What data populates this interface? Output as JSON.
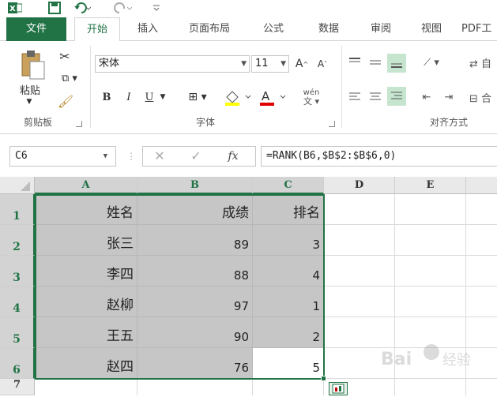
{
  "quick_access": {
    "app_icon": "excel-icon",
    "save_icon": "save-icon",
    "undo_icon": "undo-icon",
    "redo_icon": "redo-icon",
    "customize_icon": "chevron-down-icon"
  },
  "tabs": [
    {
      "label": "文件"
    },
    {
      "label": "开始"
    },
    {
      "label": "插入"
    },
    {
      "label": "页面布局"
    },
    {
      "label": "公式"
    },
    {
      "label": "数据"
    },
    {
      "label": "审阅"
    },
    {
      "label": "视图"
    },
    {
      "label": "PDF工"
    }
  ],
  "ribbon": {
    "clipboard": {
      "paste_label": "粘贴",
      "group_label": "剪贴板"
    },
    "font": {
      "font_name": "宋体",
      "font_size": "11",
      "bold": "B",
      "italic": "I",
      "underline": "U",
      "phonetic": "wén",
      "group_label": "字体"
    },
    "alignment": {
      "group_label": "对齐方式"
    }
  },
  "formula_bar": {
    "name_box": "C6",
    "fx": "fx",
    "formula": "=RANK(B6,$B$2:$B$6,0)"
  },
  "grid": {
    "columns": [
      "A",
      "B",
      "C",
      "D",
      "E"
    ],
    "rows": [
      "1",
      "2",
      "3",
      "4",
      "5",
      "6",
      "7"
    ],
    "cells": [
      [
        "姓名",
        "成绩",
        "排名"
      ],
      [
        "张三",
        "89",
        "3"
      ],
      [
        "李四",
        "88",
        "4"
      ],
      [
        "赵柳",
        "97",
        "1"
      ],
      [
        "王五",
        "90",
        "2"
      ],
      [
        "赵四",
        "76",
        "5"
      ]
    ]
  },
  "colors": {
    "accent": "#217346",
    "selection_fill": "#c6c6c6"
  }
}
